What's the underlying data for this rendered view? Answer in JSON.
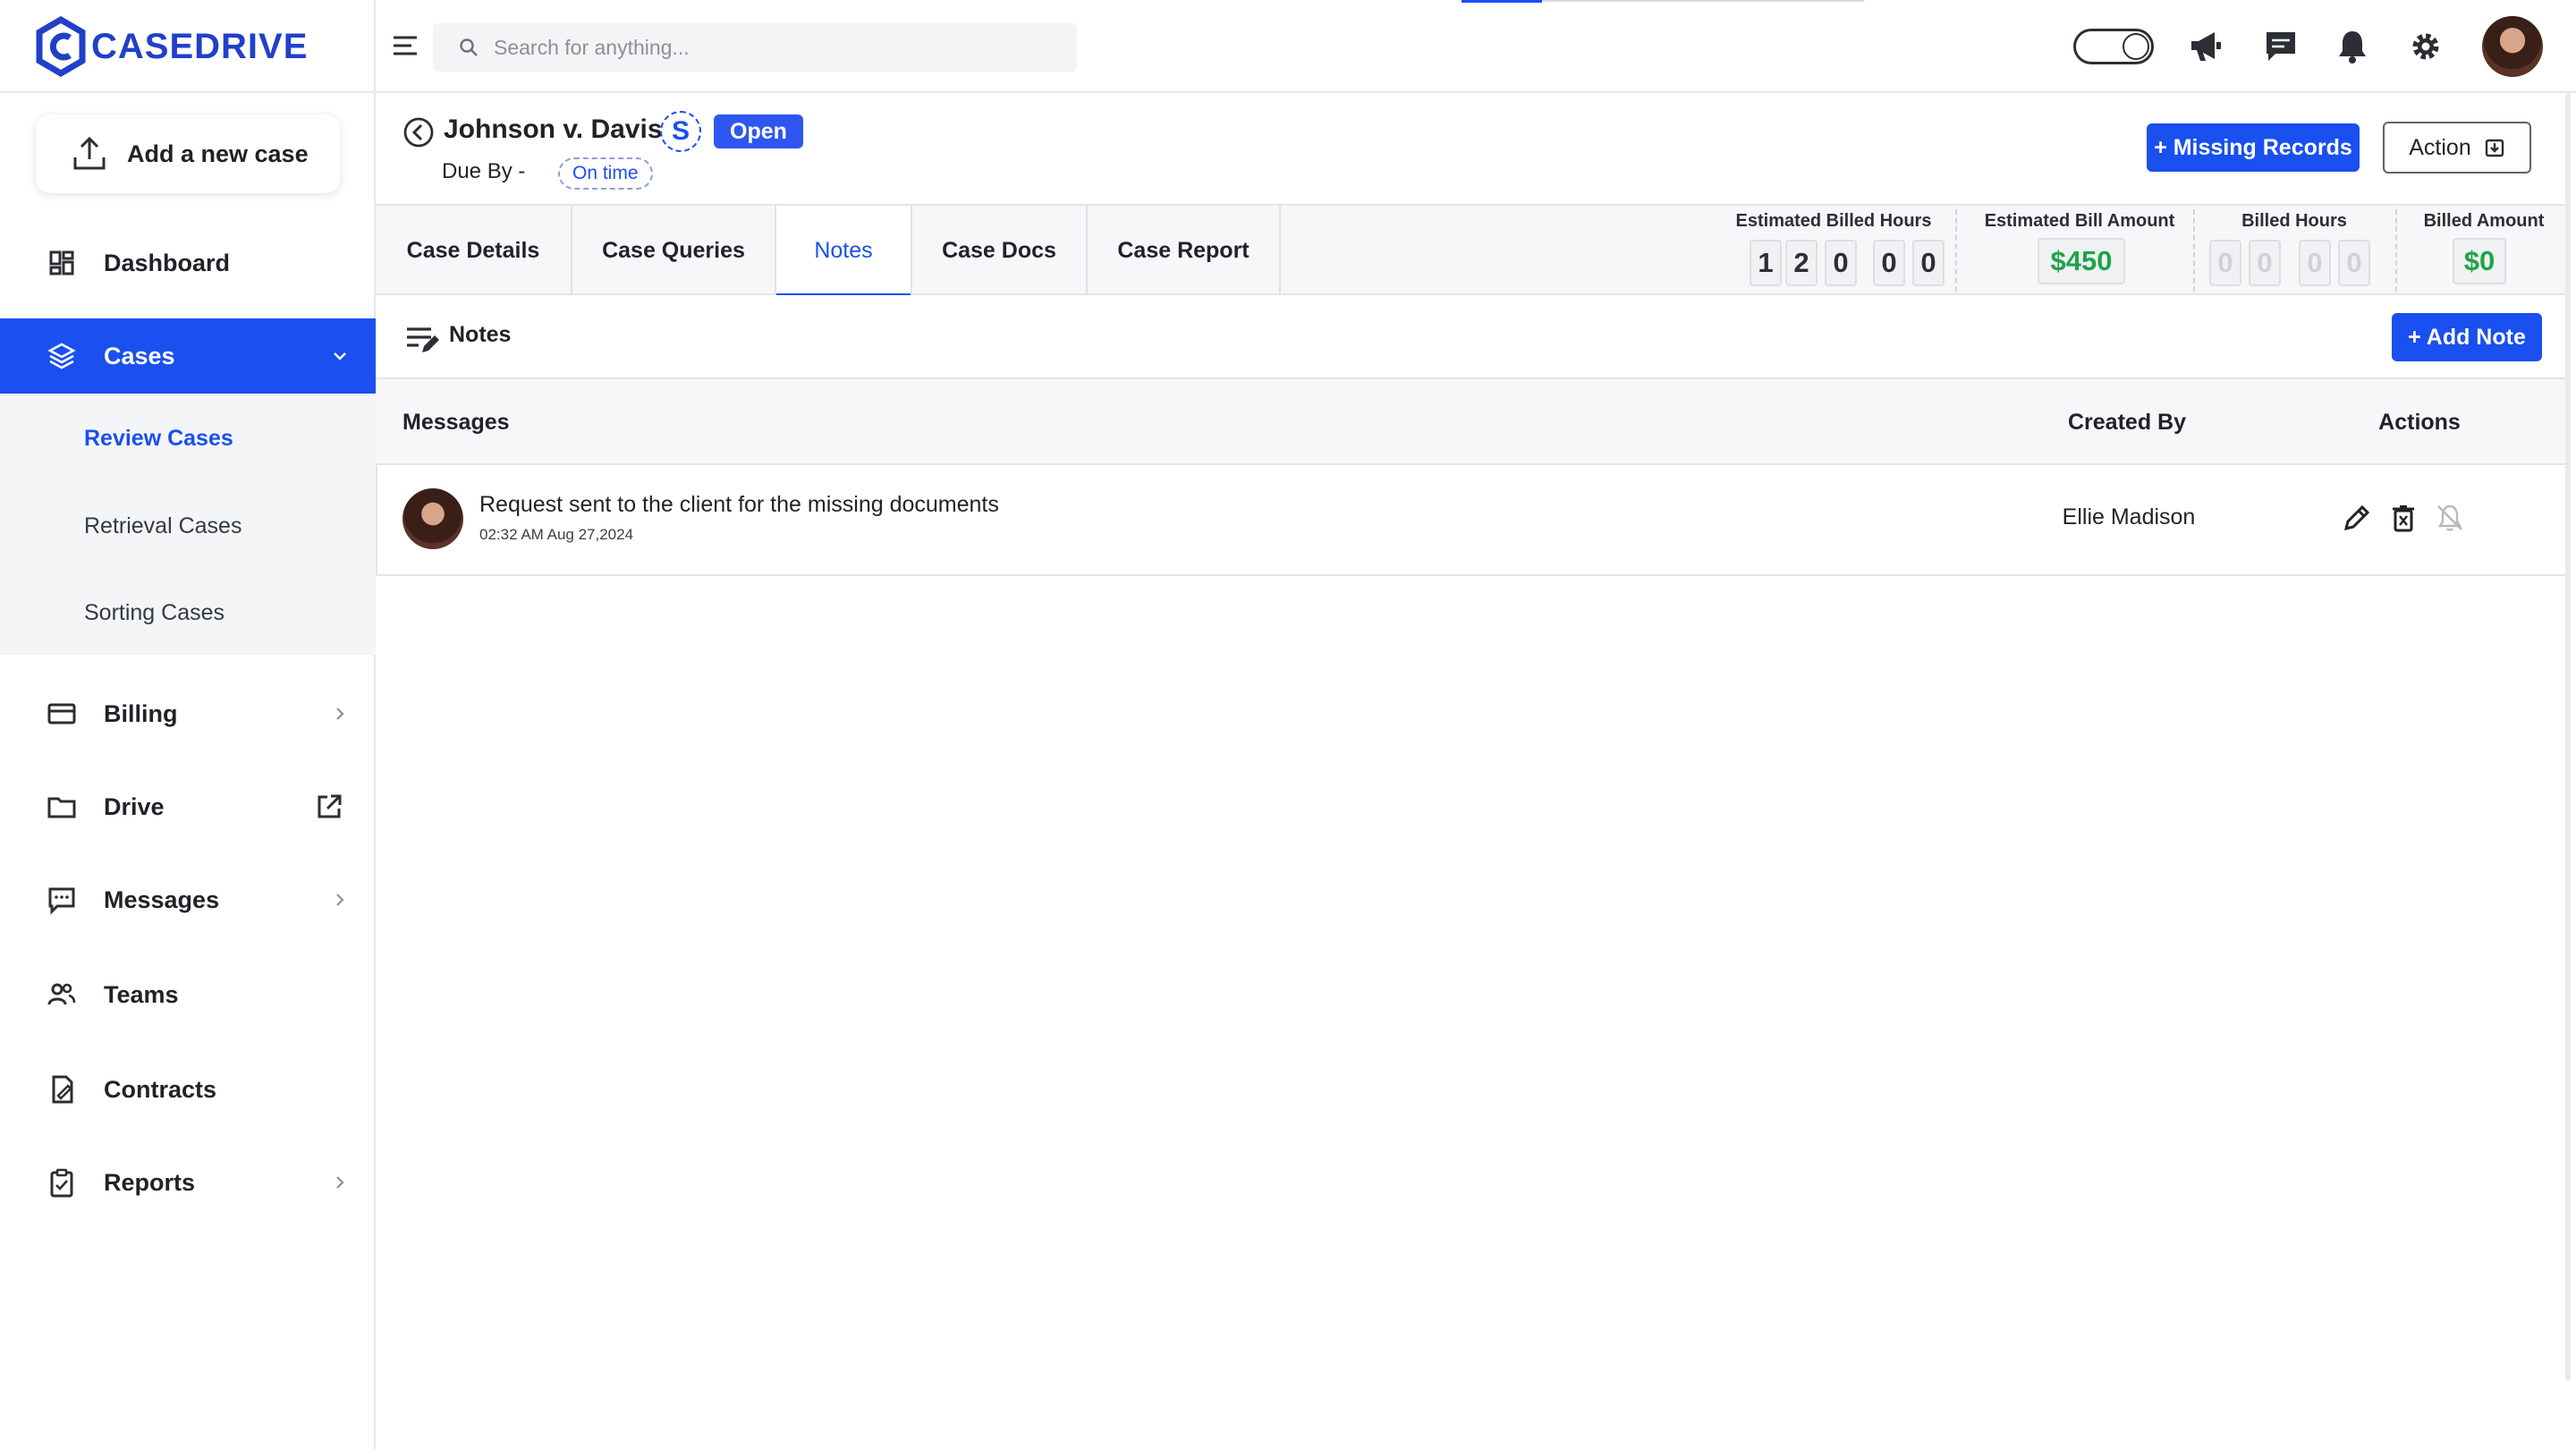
{
  "brand": {
    "name": "CASEDRIVE",
    "accent": "#1a4ff0"
  },
  "sidebar": {
    "add_case_label": "Add a new case",
    "items": [
      {
        "label": "Dashboard",
        "icon": "dashboard-icon"
      },
      {
        "label": "Cases",
        "icon": "layers-icon",
        "expanded": true
      },
      {
        "label": "Billing",
        "icon": "credit-card-icon"
      },
      {
        "label": "Drive",
        "icon": "folder-icon"
      },
      {
        "label": "Messages",
        "icon": "chat-icon"
      },
      {
        "label": "Teams",
        "icon": "team-icon"
      },
      {
        "label": "Contracts",
        "icon": "contract-icon"
      },
      {
        "label": "Reports",
        "icon": "clipboard-icon"
      }
    ],
    "sub_items": [
      {
        "label": "Review Cases",
        "active": true
      },
      {
        "label": "Retrieval Cases"
      },
      {
        "label": "Sorting Cases"
      }
    ]
  },
  "topbar": {
    "search_placeholder": "Search for anything...",
    "icons": [
      "theme-toggle",
      "megaphone-icon",
      "chat-icon",
      "bell-icon",
      "gear-icon",
      "user-avatar"
    ]
  },
  "case": {
    "title": "Johnson v. Davis",
    "badge_letter": "S",
    "status": "Open",
    "due_label": "Due By -",
    "due_status": "On time",
    "missing_records_label": "+ Missing Records",
    "action_label": "Action"
  },
  "tabs": [
    {
      "label": "Case Details"
    },
    {
      "label": "Case Queries"
    },
    {
      "label": "Notes",
      "active": true
    },
    {
      "label": "Case Docs"
    },
    {
      "label": "Case Report"
    }
  ],
  "stats": {
    "estimated_billed_hours": {
      "label": "Estimated Billed Hours",
      "digits": [
        "1",
        "2",
        "0",
        "0",
        "0"
      ]
    },
    "estimated_bill_amount": {
      "label": "Estimated Bill Amount",
      "value": "$450"
    },
    "billed_hours": {
      "label": "Billed Hours",
      "digits": [
        "0",
        "0",
        "0",
        "0"
      ]
    },
    "billed_amount": {
      "label": "Billed Amount",
      "value": "$0"
    }
  },
  "notes": {
    "section_title": "Notes",
    "add_note_label": "+ Add Note",
    "columns": {
      "messages": "Messages",
      "created_by": "Created By",
      "actions": "Actions"
    },
    "rows": [
      {
        "message": "Request sent to the client for the missing documents",
        "timestamp": "02:32 AM Aug 27,2024",
        "created_by": "Ellie Madison",
        "actions": [
          "edit-icon",
          "delete-icon",
          "bell-off-icon"
        ]
      }
    ]
  }
}
